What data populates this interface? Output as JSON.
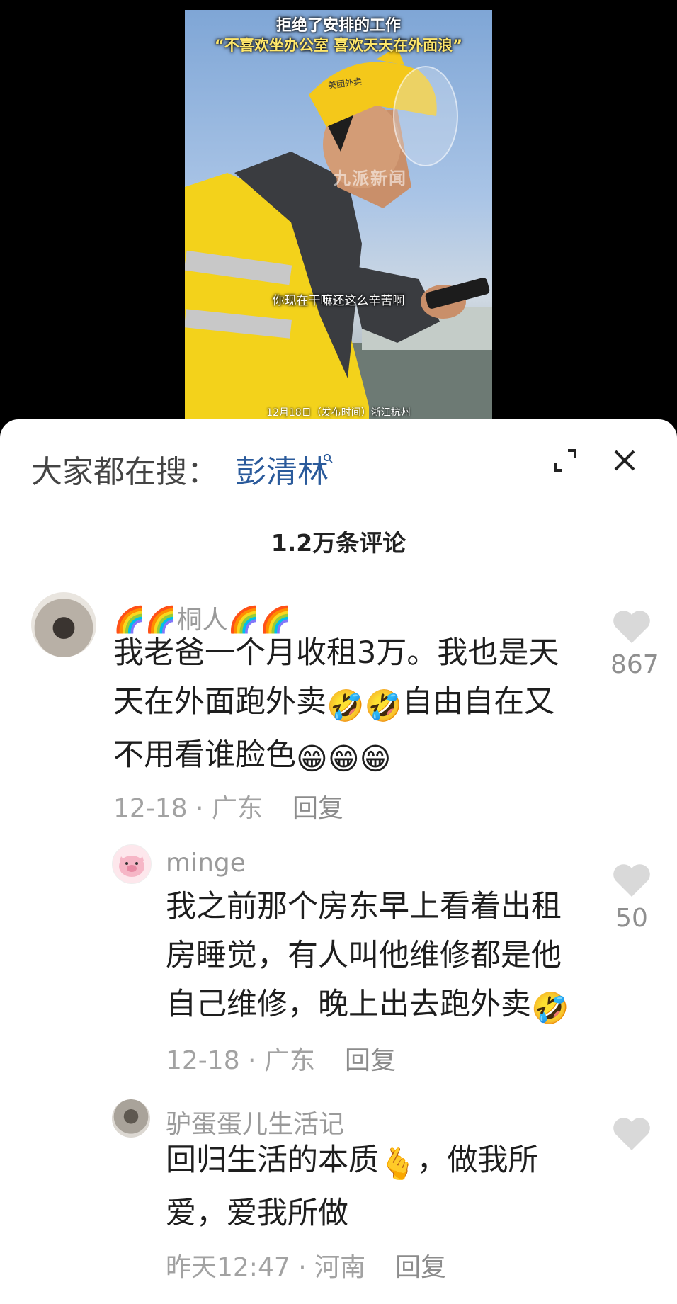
{
  "video": {
    "title_line1": "拒绝了安排的工作",
    "title_line2": "“不喜欢坐办公室 喜欢天天在外面浪”",
    "subtitle": "你现在干嘛还这么辛苦啊",
    "date_location": "12月18日（发布时间）浙江杭州",
    "watermark": "九派新闻",
    "helmet_text": "美团外卖"
  },
  "search": {
    "prefix": "大家都在搜：",
    "term": "彭清林",
    "icon": "search-icon"
  },
  "header": {
    "comment_count": "1.2万条评论",
    "expand_icon": "expand-icon",
    "close_icon": "close-icon"
  },
  "comments": [
    {
      "username": "🌈🌈桐人🌈🌈",
      "text_line1": "我老爸一个月收租3万。我也是天",
      "text_line2a": "天在外面跑外卖",
      "text_line2b": "自由自在又",
      "text_line3": "不用看谁脸色",
      "emoji_laugh_cry": "🤣",
      "emoji_grin": "😁",
      "date": "12-18 · 广东",
      "reply_label": "回复",
      "likes": "867"
    },
    {
      "username": "minge",
      "text_line1": "我之前那个房东早上看着出租",
      "text_line2": "房睡觉，有人叫他维修都是他",
      "text_line3": "自己维修，晚上出去跑外卖",
      "emoji_laugh_cry": "🤣",
      "date": "12-18 · 广东",
      "reply_label": "回复",
      "likes": "50"
    },
    {
      "username": "驴蛋蛋儿生活记",
      "text_line1a": "回归生活的本质",
      "text_line1b": "，做我所",
      "text_line2": "爱，爱我所做",
      "emoji_heart_hand": "🫰",
      "date": "昨天12:47 · 河南",
      "reply_label": "回复",
      "likes": ""
    }
  ],
  "colors": {
    "search_term": "#2a5a9b",
    "meta_gray": "#a2a2a2",
    "heart_gray": "#d9d9d9",
    "vest_yellow": "#f2d21c"
  }
}
